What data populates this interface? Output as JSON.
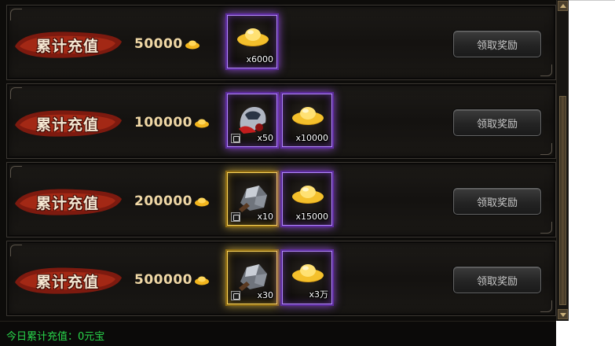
{
  "rewards": [
    {
      "label": "累计充值",
      "amount": "50000",
      "items": [
        {
          "icon": "gold-ingot-icon",
          "qty": "x6000",
          "frame": "purple",
          "locked": false
        }
      ],
      "button": "领取奖励"
    },
    {
      "label": "累计充值",
      "amount": "100000",
      "items": [
        {
          "icon": "warrior-helmet-icon",
          "qty": "x50",
          "frame": "purple",
          "locked": true
        },
        {
          "icon": "gold-ingot-icon",
          "qty": "x10000",
          "frame": "purple",
          "locked": false
        }
      ],
      "button": "领取奖励"
    },
    {
      "label": "累计充值",
      "amount": "200000",
      "items": [
        {
          "icon": "iron-ore-icon",
          "qty": "x10",
          "frame": "gold",
          "locked": true
        },
        {
          "icon": "gold-ingot-icon",
          "qty": "x15000",
          "frame": "purple",
          "locked": false
        }
      ],
      "button": "领取奖励"
    },
    {
      "label": "累计充值",
      "amount": "500000",
      "items": [
        {
          "icon": "iron-ore-icon",
          "qty": "x30",
          "frame": "gold",
          "locked": true
        },
        {
          "icon": "gold-ingot-icon",
          "qty": "x3万",
          "frame": "purple",
          "locked": false
        }
      ],
      "button": "领取奖励"
    }
  ],
  "footer": {
    "today_recharge": "今日累计充值：0元宝"
  },
  "colors": {
    "banner_red": "#8a1c10",
    "amount_text": "#f0d8a6",
    "footer_green": "#29d64b",
    "purple_frame": "#b489ff",
    "gold_frame": "#ffd75a"
  }
}
